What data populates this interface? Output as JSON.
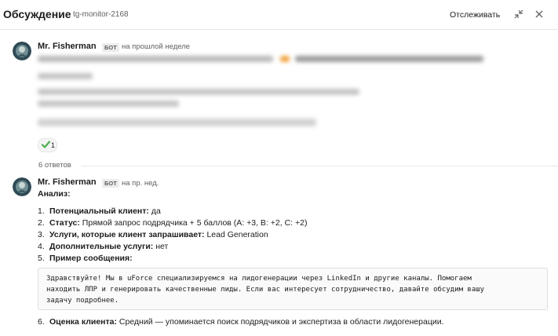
{
  "header": {
    "title": "Обсуждение",
    "channel": "tg-monitor-2168",
    "follow_label": "Отслеживать"
  },
  "icons": {
    "collapse": "collapse-arrows-icon",
    "close": "close-icon",
    "reaction": "white-check-mark-icon"
  },
  "colors": {
    "reaction_check": "#4caf50",
    "avatar_bg": "#2f4a55"
  },
  "parent_message": {
    "author": "Mr. Fisherman",
    "badge": "БОТ",
    "time": "на прошлой неделе",
    "reaction_count": "1"
  },
  "replies": {
    "count_label": "6 ответов"
  },
  "reply": {
    "author": "Mr. Fisherman",
    "badge": "БОТ",
    "time": "на пр. нед.",
    "heading": "Анализ:",
    "items": [
      {
        "num": "1.",
        "label": "Потенциальный клиент:",
        "value": " да"
      },
      {
        "num": "2.",
        "label": "Статус:",
        "value": " Прямой запрос подрядчика + 5 баллов (A: +3, B: +2, C: +2)"
      },
      {
        "num": "3.",
        "label": "Услуги, которые клиент запрашивает:",
        "value": " Lead Generation"
      },
      {
        "num": "4.",
        "label": "Дополнительные услуги:",
        "value": " нет"
      },
      {
        "num": "5.",
        "label": "Пример сообщения:",
        "value": ""
      },
      {
        "num": "6.",
        "label": "Оценка клиента:",
        "value": " Средний — упоминается поиск подрядчиков и экспертиза в области лидогенерации."
      }
    ],
    "code": "Здравствуйте! Мы в uForce специализируемся на лидогенерации через LinkedIn и другие каналы. Помогаем\nнаходить ЛПР и генерировать качественные лиды. Если вас интересует сотрудничество, давайте обсудим вашу\nзадачу подробнее."
  }
}
